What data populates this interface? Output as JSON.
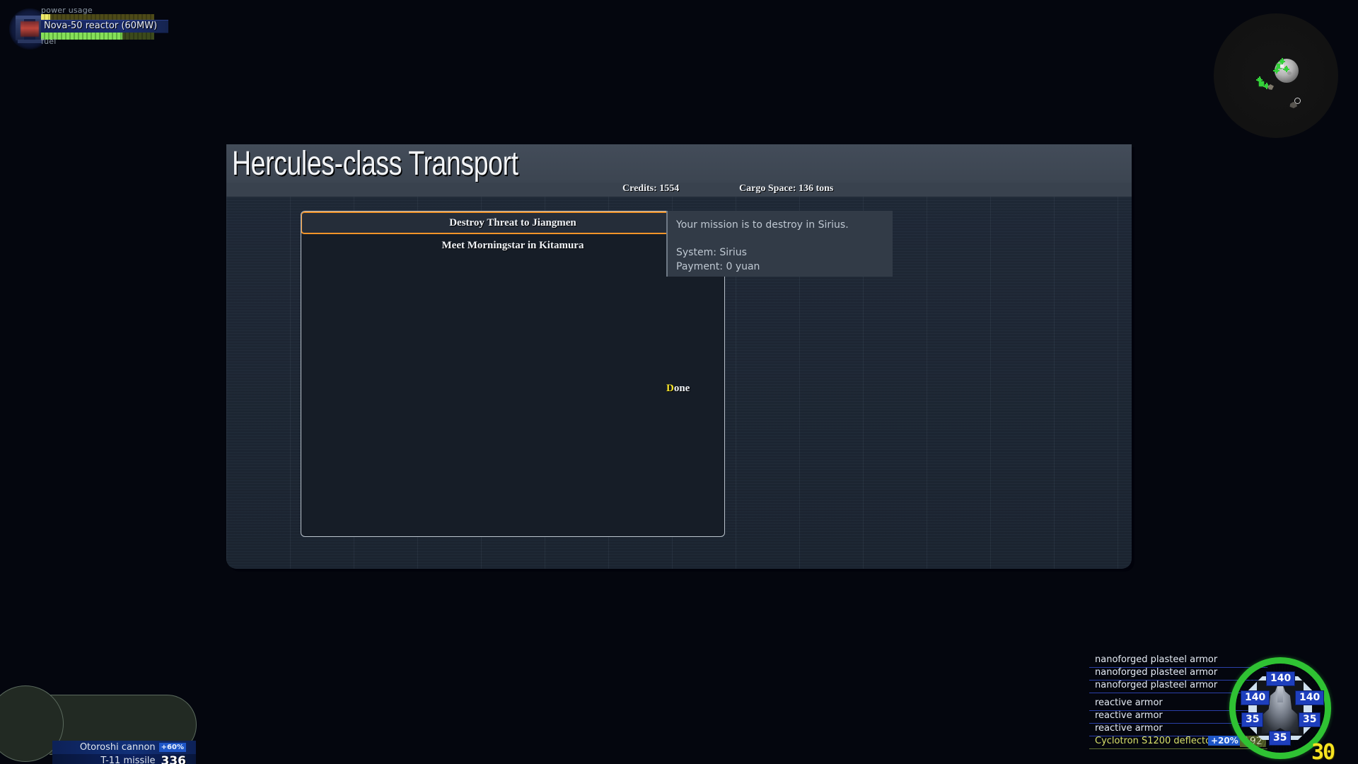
{
  "hud": {
    "reactor": {
      "icon": "reactor-icon",
      "power_label": "power usage",
      "fuel_label": "fuel",
      "name": "Nova-50 reactor (60MW)",
      "power_percent": 8,
      "fuel_percent": 72
    },
    "radar": {
      "icon": "radar-scope"
    },
    "speed": "30"
  },
  "dialog": {
    "title": "Hercules-class Transport",
    "credits_label": "Credits: 1554",
    "cargo_label": "Cargo Space:  136 tons",
    "missions": [
      {
        "label": "Destroy Threat to Jiangmen",
        "selected": true
      },
      {
        "label": "Meet Morningstar in Kitamura",
        "selected": false
      }
    ],
    "description": {
      "line1": "Your mission is to destroy  in Sirius.",
      "line2": "System: Sirius",
      "line3": "Payment: 0 yuan"
    },
    "done_button": {
      "hotkey": "D",
      "rest": "one"
    }
  },
  "weapons": [
    {
      "name": "Otoroshi cannon",
      "badge": "+60%",
      "count": ""
    },
    {
      "name": "T-11 missile",
      "badge": "",
      "count": "336"
    }
  ],
  "armor": {
    "rows": [
      {
        "name": "nanoforged plasteel armor",
        "type": "armor"
      },
      {
        "name": "nanoforged plasteel armor",
        "type": "armor"
      },
      {
        "name": "nanoforged plasteel armor",
        "type": "armor"
      },
      {
        "name": "reactive armor",
        "type": "armor"
      },
      {
        "name": "reactive armor",
        "type": "armor"
      },
      {
        "name": "reactive armor",
        "type": "armor"
      },
      {
        "name": "Cyclotron S1200 deflector",
        "type": "deflector",
        "percent": "+20%",
        "value": "192"
      }
    ],
    "ship_values": {
      "top": "140",
      "left": "140",
      "right": "140",
      "bottom_left": "35",
      "bottom_right": "35",
      "bottom": "35"
    }
  },
  "colors": {
    "accent_orange": "#f29429",
    "hotkey_yellow": "#f5e32a",
    "shield_green": "#2fc233",
    "armor_blue": "#1e3fbd",
    "panel_bg": "#1f2836",
    "title_bar": "#434c59"
  }
}
